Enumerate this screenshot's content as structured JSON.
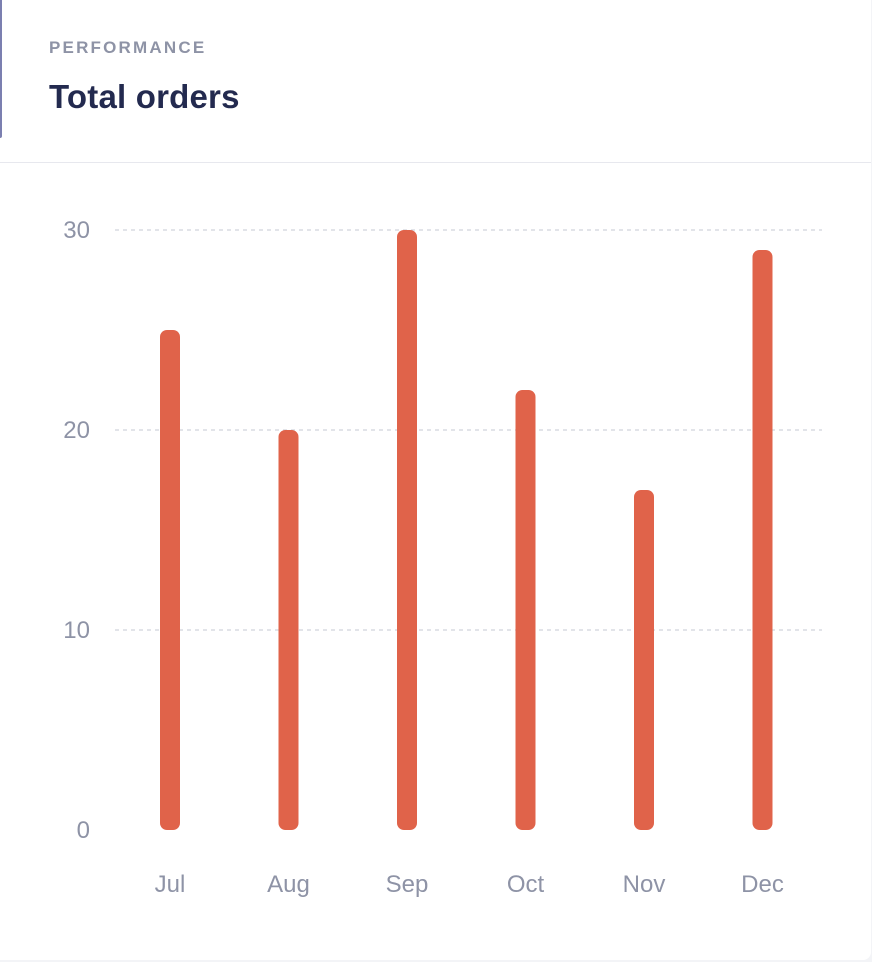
{
  "header": {
    "overline": "PERFORMANCE",
    "title": "Total orders"
  },
  "colors": {
    "bar": "#e0634a",
    "grid": "#d9dbe2",
    "tick": "#8e93a6",
    "title": "#232a4f"
  },
  "chart_data": {
    "type": "bar",
    "categories": [
      "Jul",
      "Aug",
      "Sep",
      "Oct",
      "Nov",
      "Dec"
    ],
    "values": [
      25,
      20,
      30,
      22,
      17,
      29
    ],
    "ylim": [
      0,
      30
    ],
    "yticks": [
      0,
      10,
      20,
      30
    ],
    "ytick_labels": [
      "0",
      "10",
      "20",
      "30"
    ],
    "grid": true,
    "legend": "none"
  }
}
